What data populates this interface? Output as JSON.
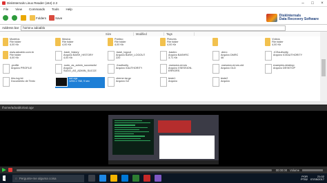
{
  "window": {
    "title": "DiskInternals Linux Reader (x64) 2.3"
  },
  "menu": [
    "File",
    "View",
    "Commands",
    "Tools",
    "Help"
  ],
  "toolbar": {
    "buttons": [
      "Folders",
      "Save"
    ],
    "logo_line1": "DiskInternals",
    "logo_line2": "Data Recovery Software"
  },
  "address": {
    "label": "Address bar",
    "path": "home ▸ adoablo"
  },
  "sort_header": [
    "Size",
    "Modified",
    "Tags"
  ],
  "items": [
    {
      "name": "Modelos",
      "info": "File folder\n4,00 Kb",
      "kind": "folder"
    },
    {
      "name": "Música",
      "info": "File folder\n4,00 Kb",
      "kind": "folder"
    },
    {
      "name": "Público",
      "info": "File folder\n4,00 Kb",
      "kind": "folder"
    },
    {
      "name": "Pictures",
      "info": "File folder\n4,00 Kb",
      "kind": "folder"
    },
    {
      "name": "",
      "info": "",
      "kind": "folder"
    },
    {
      "name": "Vídeos",
      "info": "File folder\n4,00 Kb",
      "kind": "folder"
    },
    {
      "name": "www.adoablo.com.br",
      "info": "File folder\n4,00 Kb",
      "kind": "folder"
    },
    {
      "name": ".bash_history",
      "info": "Arquivo BASH_HISTORY\n4,00 Kb",
      "kind": "doc"
    },
    {
      "name": ".bash_logout",
      "info": "Arquivo BASH_LOGOUT\n220",
      "kind": "doc"
    },
    {
      "name": ".bashrc",
      "info": "Arquivo BASHRC\n3,71 Kb",
      "kind": "doc"
    },
    {
      "name": ".dmrc",
      "info": "Arquivo DMRC\n46",
      "kind": "doc"
    },
    {
      "name": ".ICEauthority",
      "info": "Arquivo ICEAUTHORITY",
      "kind": "doc"
    },
    {
      "name": ".profile",
      "info": "Arquivo PROFILE",
      "kind": "doc"
    },
    {
      "name": ".sudo_as_admin_successful",
      "info": "Arquivo SUDO_AS_ADMIN_SUCCESS...",
      "kind": "doc"
    },
    {
      "name": ".Xauthority",
      "info": "Arquivo XAUTHORITY",
      "kind": "doc"
    },
    {
      "name": ".xsession-errors",
      "info": "Arquivo XSESSION-ERRORS",
      "kind": "doc"
    },
    {
      "name": ".xsession-errors.old",
      "info": "Arquivo OLD",
      "kind": "doc"
    },
    {
      "name": "examples.desktop",
      "info": "Arquivo DESKTOP",
      "kind": "doc"
    },
    {
      "name": "hhs-log.txt",
      "info": "Documento de Texto",
      "kind": "doc"
    },
    {
      "name": "out.ogv",
      "info": "1294 x 768, 9 sec",
      "kind": "video",
      "selected": true
    },
    {
      "name": "xtreme.tar.gz",
      "info": "Arquivo GZ",
      "kind": "doc"
    },
    {
      "name": "teste1",
      "info": "Arquivo",
      "kind": "doc"
    },
    {
      "name": "teste2",
      "info": "Arquivo",
      "kind": "doc"
    }
  ],
  "preview": {
    "path": "/home/adoablo/out.ogv"
  },
  "player": {
    "time": "00:00:00",
    "volume_label": "Volume"
  },
  "taskbar": {
    "search_placeholder": "Pergunte-me alguma coisa",
    "lang1": "POR",
    "lang2": "PTB2",
    "time": "21:02",
    "date": "07/05/2017"
  }
}
